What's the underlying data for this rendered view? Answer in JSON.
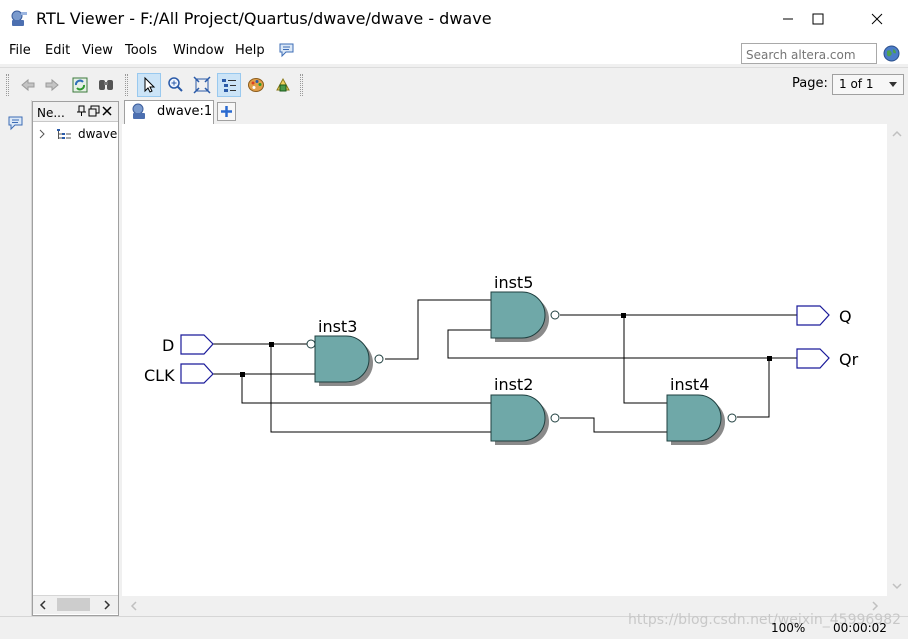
{
  "window": {
    "title": "RTL Viewer - F:/All Project/Quartus/dwave/dwave - dwave",
    "controls": [
      "minimize",
      "maximize",
      "close"
    ]
  },
  "menu": {
    "items": [
      {
        "label": "File"
      },
      {
        "label": "Edit"
      },
      {
        "label": "View"
      },
      {
        "label": "Tools"
      },
      {
        "label": "Window"
      },
      {
        "label": "Help"
      }
    ],
    "search_placeholder": "Search altera.com"
  },
  "toolbar": {
    "page_label": "Page:",
    "page_value": "1 of 1",
    "tools": [
      "back-icon",
      "forward-icon",
      "refresh-icon",
      "find-icon",
      "select-pointer-icon",
      "zoom-icon",
      "fit-icon",
      "netlist-navigator-icon",
      "color-palette-icon",
      "hierarchy-icon"
    ]
  },
  "navigator": {
    "title": "Ne...",
    "tree": [
      {
        "label": "dwave",
        "expanded": false
      }
    ]
  },
  "tabs": {
    "items": [
      {
        "label": "dwave:1",
        "active": true
      }
    ]
  },
  "schematic": {
    "inputs": [
      {
        "label": "D"
      },
      {
        "label": "CLK"
      }
    ],
    "outputs": [
      {
        "label": "Q"
      },
      {
        "label": "Qr"
      }
    ],
    "gates": [
      {
        "label": "inst3",
        "type": "NAND"
      },
      {
        "label": "inst5",
        "type": "NAND"
      },
      {
        "label": "inst2",
        "type": "NAND"
      },
      {
        "label": "inst4",
        "type": "NAND"
      }
    ],
    "gate_color": "#6fa8a8"
  },
  "status": {
    "zoom": "100%",
    "time": "00:00:02"
  },
  "watermark": "https://blog.csdn.net/weixin_45996982"
}
